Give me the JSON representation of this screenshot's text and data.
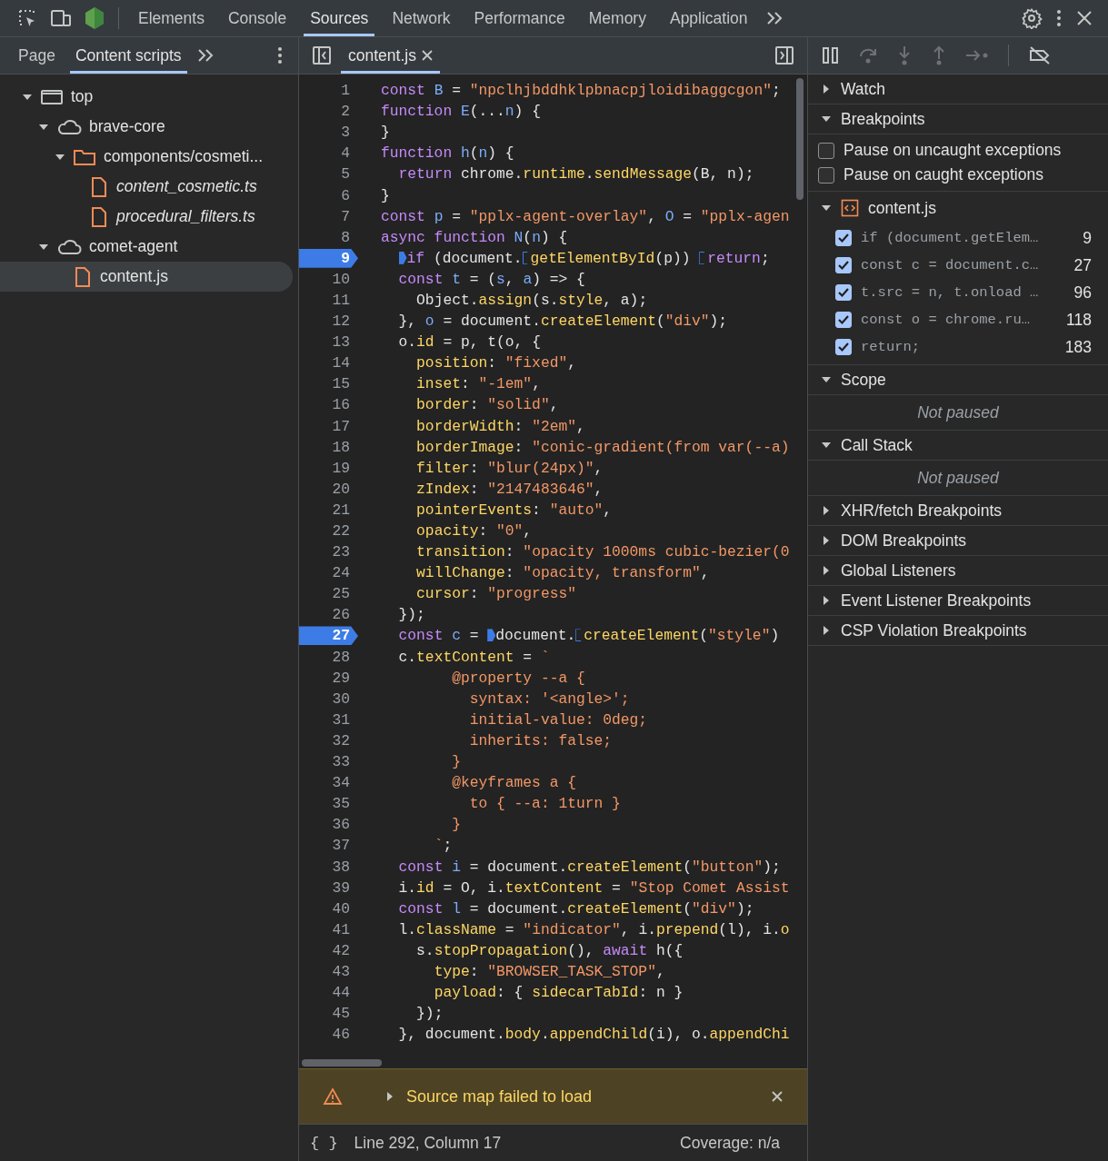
{
  "main_tabs": [
    {
      "label": "Elements",
      "selected": false
    },
    {
      "label": "Console",
      "selected": false
    },
    {
      "label": "Sources",
      "selected": true
    },
    {
      "label": "Network",
      "selected": false
    },
    {
      "label": "Performance",
      "selected": false
    },
    {
      "label": "Memory",
      "selected": false
    },
    {
      "label": "Application",
      "selected": false
    }
  ],
  "navigator": {
    "tabs": [
      {
        "label": "Page",
        "selected": false
      },
      {
        "label": "Content scripts",
        "selected": true
      }
    ],
    "tree": [
      {
        "label": "top",
        "kind": "frame",
        "expanded": true,
        "selected": false,
        "italic": false,
        "children": [
          {
            "label": "brave-core",
            "kind": "cloud",
            "expanded": true,
            "selected": false,
            "italic": false,
            "children": [
              {
                "label": "components/cosmeti...",
                "kind": "folder",
                "expanded": true,
                "selected": false,
                "italic": false,
                "children": [
                  {
                    "label": "content_cosmetic.ts",
                    "kind": "file",
                    "selected": false,
                    "italic": true
                  },
                  {
                    "label": "procedural_filters.ts",
                    "kind": "file",
                    "selected": false,
                    "italic": true
                  }
                ]
              }
            ]
          },
          {
            "label": "comet-agent",
            "kind": "cloud",
            "expanded": true,
            "selected": false,
            "italic": false,
            "children": [
              {
                "label": "content.js",
                "kind": "file",
                "selected": true,
                "italic": false
              }
            ]
          }
        ]
      }
    ]
  },
  "editor": {
    "tab": {
      "label": "content.js",
      "selected": true
    },
    "lines": [
      {
        "n": "1",
        "breakpoint": false,
        "tokens": [
          {
            "kind": "keyword",
            "text": "const "
          },
          {
            "kind": "variable",
            "text": "B"
          },
          {
            "kind": "plain",
            "text": " = "
          },
          {
            "kind": "string",
            "text": "\"npclhjbddhklpbnacpjloidibaggcgon\""
          },
          {
            "kind": "plain",
            "text": ";"
          }
        ]
      },
      {
        "n": "2",
        "breakpoint": false,
        "tokens": [
          {
            "kind": "keyword",
            "text": "function "
          },
          {
            "kind": "variable",
            "text": "E"
          },
          {
            "kind": "plain",
            "text": "(..."
          },
          {
            "kind": "variable",
            "text": "n"
          },
          {
            "kind": "plain",
            "text": ") {"
          }
        ]
      },
      {
        "n": "3",
        "breakpoint": false,
        "tokens": [
          {
            "kind": "plain",
            "text": "}"
          }
        ]
      },
      {
        "n": "4",
        "breakpoint": false,
        "tokens": [
          {
            "kind": "keyword",
            "text": "function "
          },
          {
            "kind": "variable",
            "text": "h"
          },
          {
            "kind": "plain",
            "text": "("
          },
          {
            "kind": "variable",
            "text": "n"
          },
          {
            "kind": "plain",
            "text": ") {"
          }
        ]
      },
      {
        "n": "5",
        "breakpoint": false,
        "tokens": [
          {
            "kind": "keyword",
            "text": "  return "
          },
          {
            "kind": "plain",
            "text": "chrome."
          },
          {
            "kind": "property",
            "text": "runtime"
          },
          {
            "kind": "plain",
            "text": "."
          },
          {
            "kind": "property",
            "text": "sendMessage"
          },
          {
            "kind": "plain",
            "text": "(B, n);"
          }
        ]
      },
      {
        "n": "6",
        "breakpoint": false,
        "tokens": [
          {
            "kind": "plain",
            "text": "}"
          }
        ]
      },
      {
        "n": "7",
        "breakpoint": false,
        "tokens": [
          {
            "kind": "keyword",
            "text": "const "
          },
          {
            "kind": "variable",
            "text": "p"
          },
          {
            "kind": "plain",
            "text": " = "
          },
          {
            "kind": "string",
            "text": "\"pplx-agent-overlay\""
          },
          {
            "kind": "plain",
            "text": ", "
          },
          {
            "kind": "variable",
            "text": "O"
          },
          {
            "kind": "plain",
            "text": " = "
          },
          {
            "kind": "string",
            "text": "\"pplx-agen"
          }
        ]
      },
      {
        "n": "8",
        "breakpoint": false,
        "tokens": [
          {
            "kind": "keyword",
            "text": "async function "
          },
          {
            "kind": "variable",
            "text": "N"
          },
          {
            "kind": "plain",
            "text": "("
          },
          {
            "kind": "variable",
            "text": "n"
          },
          {
            "kind": "plain",
            "text": ") {"
          }
        ]
      },
      {
        "n": "9",
        "breakpoint": true,
        "tokens": [
          {
            "kind": "keyword",
            "text": "  if",
            "marker": {
              "filled": true
            }
          },
          {
            "kind": "plain",
            "text": " (document."
          },
          {
            "kind": "property",
            "text": "getElementById",
            "marker": {
              "filled": false
            }
          },
          {
            "kind": "plain",
            "text": "(p)) "
          },
          {
            "kind": "keyword",
            "text": "return",
            "marker": {
              "filled": false
            }
          },
          {
            "kind": "plain",
            "text": ";"
          }
        ]
      },
      {
        "n": "10",
        "breakpoint": false,
        "tokens": [
          {
            "kind": "keyword",
            "text": "  const "
          },
          {
            "kind": "variable",
            "text": "t"
          },
          {
            "kind": "plain",
            "text": " = ("
          },
          {
            "kind": "variable",
            "text": "s"
          },
          {
            "kind": "plain",
            "text": ", "
          },
          {
            "kind": "variable",
            "text": "a"
          },
          {
            "kind": "plain",
            "text": ") => {"
          }
        ]
      },
      {
        "n": "11",
        "breakpoint": false,
        "tokens": [
          {
            "kind": "plain",
            "text": "    Object."
          },
          {
            "kind": "property",
            "text": "assign"
          },
          {
            "kind": "plain",
            "text": "(s."
          },
          {
            "kind": "property",
            "text": "style"
          },
          {
            "kind": "plain",
            "text": ", a);"
          }
        ]
      },
      {
        "n": "12",
        "breakpoint": false,
        "tokens": [
          {
            "kind": "plain",
            "text": "  }, "
          },
          {
            "kind": "variable",
            "text": "o"
          },
          {
            "kind": "plain",
            "text": " = document."
          },
          {
            "kind": "property",
            "text": "createElement"
          },
          {
            "kind": "plain",
            "text": "("
          },
          {
            "kind": "string",
            "text": "\"div\""
          },
          {
            "kind": "plain",
            "text": ");"
          }
        ]
      },
      {
        "n": "13",
        "breakpoint": false,
        "tokens": [
          {
            "kind": "plain",
            "text": "  o."
          },
          {
            "kind": "property",
            "text": "id"
          },
          {
            "kind": "plain",
            "text": " = p, t(o, {"
          }
        ]
      },
      {
        "n": "14",
        "breakpoint": false,
        "tokens": [
          {
            "kind": "property",
            "text": "    position"
          },
          {
            "kind": "plain",
            "text": ": "
          },
          {
            "kind": "string",
            "text": "\"fixed\""
          },
          {
            "kind": "plain",
            "text": ","
          }
        ]
      },
      {
        "n": "15",
        "breakpoint": false,
        "tokens": [
          {
            "kind": "property",
            "text": "    inset"
          },
          {
            "kind": "plain",
            "text": ": "
          },
          {
            "kind": "string",
            "text": "\"-1em\""
          },
          {
            "kind": "plain",
            "text": ","
          }
        ]
      },
      {
        "n": "16",
        "breakpoint": false,
        "tokens": [
          {
            "kind": "property",
            "text": "    border"
          },
          {
            "kind": "plain",
            "text": ": "
          },
          {
            "kind": "string",
            "text": "\"solid\""
          },
          {
            "kind": "plain",
            "text": ","
          }
        ]
      },
      {
        "n": "17",
        "breakpoint": false,
        "tokens": [
          {
            "kind": "property",
            "text": "    borderWidth"
          },
          {
            "kind": "plain",
            "text": ": "
          },
          {
            "kind": "string",
            "text": "\"2em\""
          },
          {
            "kind": "plain",
            "text": ","
          }
        ]
      },
      {
        "n": "18",
        "breakpoint": false,
        "tokens": [
          {
            "kind": "property",
            "text": "    borderImage"
          },
          {
            "kind": "plain",
            "text": ": "
          },
          {
            "kind": "string",
            "text": "\"conic-gradient(from var(--a)"
          }
        ]
      },
      {
        "n": "19",
        "breakpoint": false,
        "tokens": [
          {
            "kind": "property",
            "text": "    filter"
          },
          {
            "kind": "plain",
            "text": ": "
          },
          {
            "kind": "string",
            "text": "\"blur(24px)\""
          },
          {
            "kind": "plain",
            "text": ","
          }
        ]
      },
      {
        "n": "20",
        "breakpoint": false,
        "tokens": [
          {
            "kind": "property",
            "text": "    zIndex"
          },
          {
            "kind": "plain",
            "text": ": "
          },
          {
            "kind": "string",
            "text": "\"2147483646\""
          },
          {
            "kind": "plain",
            "text": ","
          }
        ]
      },
      {
        "n": "21",
        "breakpoint": false,
        "tokens": [
          {
            "kind": "property",
            "text": "    pointerEvents"
          },
          {
            "kind": "plain",
            "text": ": "
          },
          {
            "kind": "string",
            "text": "\"auto\""
          },
          {
            "kind": "plain",
            "text": ","
          }
        ]
      },
      {
        "n": "22",
        "breakpoint": false,
        "tokens": [
          {
            "kind": "property",
            "text": "    opacity"
          },
          {
            "kind": "plain",
            "text": ": "
          },
          {
            "kind": "string",
            "text": "\"0\""
          },
          {
            "kind": "plain",
            "text": ","
          }
        ]
      },
      {
        "n": "23",
        "breakpoint": false,
        "tokens": [
          {
            "kind": "property",
            "text": "    transition"
          },
          {
            "kind": "plain",
            "text": ": "
          },
          {
            "kind": "string",
            "text": "\"opacity 1000ms cubic-bezier(0"
          }
        ]
      },
      {
        "n": "24",
        "breakpoint": false,
        "tokens": [
          {
            "kind": "property",
            "text": "    willChange"
          },
          {
            "kind": "plain",
            "text": ": "
          },
          {
            "kind": "string",
            "text": "\"opacity, transform\""
          },
          {
            "kind": "plain",
            "text": ","
          }
        ]
      },
      {
        "n": "25",
        "breakpoint": false,
        "tokens": [
          {
            "kind": "property",
            "text": "    cursor"
          },
          {
            "kind": "plain",
            "text": ": "
          },
          {
            "kind": "string",
            "text": "\"progress\""
          }
        ]
      },
      {
        "n": "26",
        "breakpoint": false,
        "tokens": [
          {
            "kind": "plain",
            "text": "  });"
          }
        ]
      },
      {
        "n": "27",
        "breakpoint": true,
        "tokens": [
          {
            "kind": "keyword",
            "text": "  const "
          },
          {
            "kind": "variable",
            "text": "c"
          },
          {
            "kind": "plain",
            "text": " = "
          },
          {
            "kind": "plain",
            "text": "document.",
            "marker": {
              "filled": true
            }
          },
          {
            "kind": "property",
            "text": "createElement",
            "marker": {
              "filled": false
            }
          },
          {
            "kind": "plain",
            "text": "("
          },
          {
            "kind": "string",
            "text": "\"style\""
          },
          {
            "kind": "plain",
            "text": ")"
          }
        ]
      },
      {
        "n": "28",
        "breakpoint": false,
        "tokens": [
          {
            "kind": "plain",
            "text": "  c."
          },
          {
            "kind": "property",
            "text": "textContent"
          },
          {
            "kind": "plain",
            "text": " = "
          },
          {
            "kind": "string",
            "text": "`"
          }
        ]
      },
      {
        "n": "29",
        "breakpoint": false,
        "tokens": [
          {
            "kind": "string",
            "text": "        @property --a {"
          }
        ]
      },
      {
        "n": "30",
        "breakpoint": false,
        "tokens": [
          {
            "kind": "string",
            "text": "          syntax: '<angle>';"
          }
        ]
      },
      {
        "n": "31",
        "breakpoint": false,
        "tokens": [
          {
            "kind": "string",
            "text": "          initial-value: 0deg;"
          }
        ]
      },
      {
        "n": "32",
        "breakpoint": false,
        "tokens": [
          {
            "kind": "string",
            "text": "          inherits: false;"
          }
        ]
      },
      {
        "n": "33",
        "breakpoint": false,
        "tokens": [
          {
            "kind": "string",
            "text": "        }"
          }
        ]
      },
      {
        "n": "34",
        "breakpoint": false,
        "tokens": [
          {
            "kind": "string",
            "text": "        @keyframes a {"
          }
        ]
      },
      {
        "n": "35",
        "breakpoint": false,
        "tokens": [
          {
            "kind": "string",
            "text": "          to { --a: 1turn }"
          }
        ]
      },
      {
        "n": "36",
        "breakpoint": false,
        "tokens": [
          {
            "kind": "string",
            "text": "        }"
          }
        ]
      },
      {
        "n": "37",
        "breakpoint": false,
        "tokens": [
          {
            "kind": "string",
            "text": "      `"
          },
          {
            "kind": "plain",
            "text": ";"
          }
        ]
      },
      {
        "n": "38",
        "breakpoint": false,
        "tokens": [
          {
            "kind": "keyword",
            "text": "  const "
          },
          {
            "kind": "variable",
            "text": "i"
          },
          {
            "kind": "plain",
            "text": " = document."
          },
          {
            "kind": "property",
            "text": "createElement"
          },
          {
            "kind": "plain",
            "text": "("
          },
          {
            "kind": "string",
            "text": "\"button\""
          },
          {
            "kind": "plain",
            "text": ");"
          }
        ]
      },
      {
        "n": "39",
        "breakpoint": false,
        "tokens": [
          {
            "kind": "plain",
            "text": "  i."
          },
          {
            "kind": "property",
            "text": "id"
          },
          {
            "kind": "plain",
            "text": " = O, i."
          },
          {
            "kind": "property",
            "text": "textContent"
          },
          {
            "kind": "plain",
            "text": " = "
          },
          {
            "kind": "string",
            "text": "\"Stop Comet Assist"
          }
        ]
      },
      {
        "n": "40",
        "breakpoint": false,
        "tokens": [
          {
            "kind": "keyword",
            "text": "  const "
          },
          {
            "kind": "variable",
            "text": "l"
          },
          {
            "kind": "plain",
            "text": " = document."
          },
          {
            "kind": "property",
            "text": "createElement"
          },
          {
            "kind": "plain",
            "text": "("
          },
          {
            "kind": "string",
            "text": "\"div\""
          },
          {
            "kind": "plain",
            "text": ");"
          }
        ]
      },
      {
        "n": "41",
        "breakpoint": false,
        "tokens": [
          {
            "kind": "plain",
            "text": "  l."
          },
          {
            "kind": "property",
            "text": "className"
          },
          {
            "kind": "plain",
            "text": " = "
          },
          {
            "kind": "string",
            "text": "\"indicator\""
          },
          {
            "kind": "plain",
            "text": ", i."
          },
          {
            "kind": "property",
            "text": "prepend"
          },
          {
            "kind": "plain",
            "text": "(l), i."
          },
          {
            "kind": "property",
            "text": "o"
          }
        ]
      },
      {
        "n": "42",
        "breakpoint": false,
        "tokens": [
          {
            "kind": "plain",
            "text": "    s."
          },
          {
            "kind": "property",
            "text": "stopPropagation"
          },
          {
            "kind": "plain",
            "text": "(), "
          },
          {
            "kind": "keyword",
            "text": "await "
          },
          {
            "kind": "plain",
            "text": "h({"
          }
        ]
      },
      {
        "n": "43",
        "breakpoint": false,
        "tokens": [
          {
            "kind": "property",
            "text": "      type"
          },
          {
            "kind": "plain",
            "text": ": "
          },
          {
            "kind": "string",
            "text": "\"BROWSER_TASK_STOP\""
          },
          {
            "kind": "plain",
            "text": ","
          }
        ]
      },
      {
        "n": "44",
        "breakpoint": false,
        "tokens": [
          {
            "kind": "property",
            "text": "      payload"
          },
          {
            "kind": "plain",
            "text": ": { "
          },
          {
            "kind": "property",
            "text": "sidecarTabId"
          },
          {
            "kind": "plain",
            "text": ": n }"
          }
        ]
      },
      {
        "n": "45",
        "breakpoint": false,
        "tokens": [
          {
            "kind": "plain",
            "text": "    });"
          }
        ]
      },
      {
        "n": "46",
        "breakpoint": false,
        "tokens": [
          {
            "kind": "plain",
            "text": "  }, document."
          },
          {
            "kind": "property",
            "text": "body"
          },
          {
            "kind": "plain",
            "text": "."
          },
          {
            "kind": "property",
            "text": "appendChild"
          },
          {
            "kind": "plain",
            "text": "(i), o."
          },
          {
            "kind": "property",
            "text": "appendChi"
          }
        ]
      }
    ],
    "warning": {
      "message": "Source map failed to load",
      "expanded": false
    },
    "status": {
      "format": "{ }",
      "position": "Line 292, Column 17",
      "coverage": "Coverage: n/a"
    }
  },
  "debugger": {
    "sections": [
      {
        "title": "Watch",
        "expanded": false
      },
      {
        "title": "Breakpoints",
        "expanded": true,
        "options": [
          {
            "label": "Pause on uncaught exceptions",
            "checked": false
          },
          {
            "label": "Pause on caught exceptions",
            "checked": false
          }
        ],
        "files": [
          {
            "name": "content.js",
            "expanded": true,
            "breakpoints": [
              {
                "code": "if (document.getElem…",
                "line": "9",
                "checked": true
              },
              {
                "code": "const c = document.c…",
                "line": "27",
                "checked": true
              },
              {
                "code": "t.src = n, t.onload …",
                "line": "96",
                "checked": true
              },
              {
                "code": "const o = chrome.ru…",
                "line": "118",
                "checked": true
              },
              {
                "code": "return;",
                "line": "183",
                "checked": true
              }
            ]
          }
        ]
      },
      {
        "title": "Scope",
        "expanded": true,
        "message": "Not paused"
      },
      {
        "title": "Call Stack",
        "expanded": true,
        "message": "Not paused"
      },
      {
        "title": "XHR/fetch Breakpoints",
        "expanded": false
      },
      {
        "title": "DOM Breakpoints",
        "expanded": false
      },
      {
        "title": "Global Listeners",
        "expanded": false
      },
      {
        "title": "Event Listener Breakpoints",
        "expanded": false
      },
      {
        "title": "CSP Violation Breakpoints",
        "expanded": false
      }
    ]
  }
}
